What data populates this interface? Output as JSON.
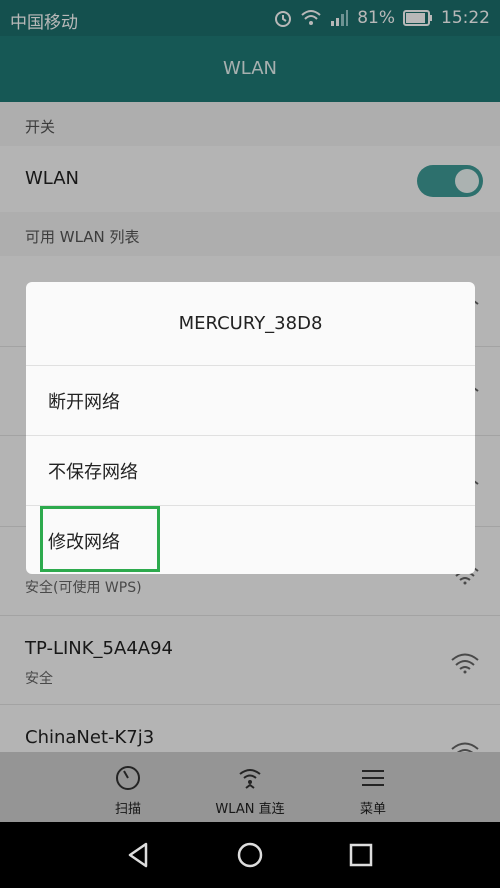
{
  "status": {
    "carrier": "中国移动",
    "battery": "81%",
    "time": "15:22"
  },
  "appbar": {
    "title": "WLAN"
  },
  "sections": {
    "switch_label": "开关",
    "available_label": "可用 WLAN 列表"
  },
  "wlan_row": {
    "label": "WLAN",
    "enabled": true
  },
  "networks": [
    {
      "ssid": "TP-LINK_5A4A94",
      "security": "安全"
    },
    {
      "ssid": "ChinaNet-K7j3",
      "security": ""
    }
  ],
  "partial_row": {
    "security": "安全(可使用 WPS)"
  },
  "dialog": {
    "title": "MERCURY_38D8",
    "options": [
      "断开网络",
      "不保存网络",
      "修改网络"
    ]
  },
  "tabs": [
    {
      "label": "扫描",
      "icon": "scan-icon"
    },
    {
      "label": "WLAN 直连",
      "icon": "wifi-direct-icon"
    },
    {
      "label": "菜单",
      "icon": "menu-icon"
    }
  ],
  "colors": {
    "statusbar": "#1d6f6c",
    "appbar": "#1f7a77",
    "toggle": "#3f9b97",
    "highlight": "#2daa4d"
  }
}
